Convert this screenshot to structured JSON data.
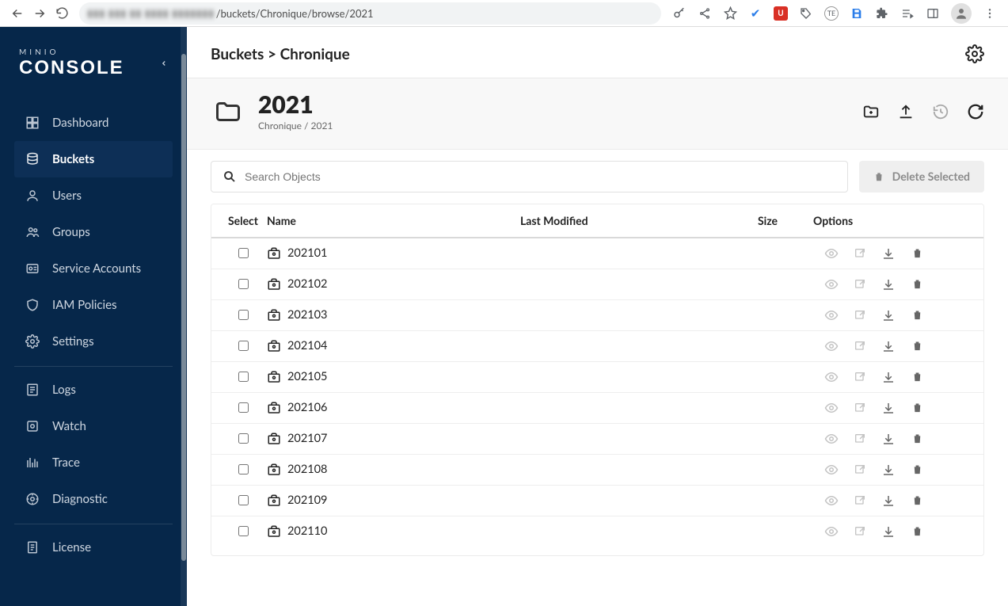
{
  "chrome": {
    "url_visible": "/buckets/Chronique/browse/2021"
  },
  "sidebar": {
    "brand_top": "MINIO",
    "brand_main": "CONSOLE",
    "groups": [
      {
        "items": [
          {
            "label": "Dashboard",
            "icon": "dashboard-icon",
            "active": false
          },
          {
            "label": "Buckets",
            "icon": "buckets-icon",
            "active": true
          },
          {
            "label": "Users",
            "icon": "users-icon",
            "active": false
          },
          {
            "label": "Groups",
            "icon": "groups-icon",
            "active": false
          },
          {
            "label": "Service Accounts",
            "icon": "service-accounts-icon",
            "active": false
          },
          {
            "label": "IAM Policies",
            "icon": "shield-icon",
            "active": false
          },
          {
            "label": "Settings",
            "icon": "settings-icon",
            "active": false
          }
        ]
      },
      {
        "items": [
          {
            "label": "Logs",
            "icon": "logs-icon",
            "active": false
          },
          {
            "label": "Watch",
            "icon": "watch-icon",
            "active": false
          },
          {
            "label": "Trace",
            "icon": "trace-icon",
            "active": false
          },
          {
            "label": "Diagnostic",
            "icon": "diagnostic-icon",
            "active": false
          }
        ]
      },
      {
        "items": [
          {
            "label": "License",
            "icon": "license-icon",
            "active": false
          }
        ]
      }
    ]
  },
  "breadcrumb": "Buckets > Chronique",
  "folder": {
    "title": "2021",
    "path": "Chronique / 2021"
  },
  "search": {
    "placeholder": "Search Objects"
  },
  "delete_btn": "Delete Selected",
  "table": {
    "headers": {
      "select": "Select",
      "name": "Name",
      "modified": "Last Modified",
      "size": "Size",
      "options": "Options"
    },
    "rows": [
      {
        "name": "202101"
      },
      {
        "name": "202102"
      },
      {
        "name": "202103"
      },
      {
        "name": "202104"
      },
      {
        "name": "202105"
      },
      {
        "name": "202106"
      },
      {
        "name": "202107"
      },
      {
        "name": "202108"
      },
      {
        "name": "202109"
      },
      {
        "name": "202110"
      }
    ]
  }
}
